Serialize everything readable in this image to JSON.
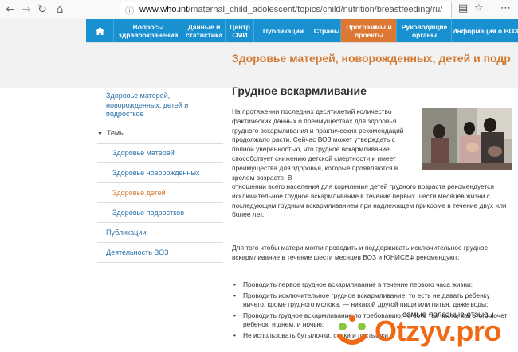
{
  "browser": {
    "url_domain": "www.who.int",
    "url_path": "/maternal_child_adolescent/topics/child/nutrition/breastfeeding/ru/"
  },
  "nav": {
    "items": [
      {
        "label": "Вопросы здравоохранения",
        "active": false
      },
      {
        "label": "Данные и статистика",
        "active": false
      },
      {
        "label": "Центр СМИ",
        "active": false
      },
      {
        "label": "Публикации",
        "active": false
      },
      {
        "label": "Страны",
        "active": false
      },
      {
        "label": "Программы и проекты",
        "active": true
      },
      {
        "label": "Руководящие органы",
        "active": false
      },
      {
        "label": "Информация о ВОЗ",
        "active": false
      }
    ]
  },
  "section_title": "Здоровье матерей, новорожденных, детей и подр",
  "sidebar": {
    "items": [
      {
        "label": "Здоровье матерей, новорожденных, детей и подростков"
      },
      {
        "label": "Темы"
      },
      {
        "label": "Здоровье матерей"
      },
      {
        "label": "Здоровье новорожденных"
      },
      {
        "label": "Здоровье детей"
      },
      {
        "label": "Здоровье подростков"
      },
      {
        "label": "Публикации"
      },
      {
        "label": "Деятельность ВОЗ"
      }
    ]
  },
  "article": {
    "title": "Грудное вскармливание",
    "para1": "На протяжении последних десятилетий количество фактических данных о преимуществах для здоровья грудного вскармливания и практических рекомендаций продолжало расти. Сейчас ВОЗ может утверждать с полной уверенностью, что грудное вскармливание способствует снижению детской смертности и имеет преимущества для здоровья, которые проявляются в зрелом возрасте. В",
    "para1b": "отношении всего населения для кормления детей грудного возраста рекомендуется исключительное грудное вскармливание в течение первых шести месяцев жизни с последующим грудным вскармливанием при надлежащем прикорме в течение двух или более лет.",
    "para2": "Для того чтобы матери могли проводить и поддерживать исключительное грудное вскармливание в течение шести месяцев ВОЗ и ЮНИСЕФ рекомендуют:",
    "bullets": [
      "Проводить первое грудное вскармливание в течение первого часа жизни;",
      "Проводить исключительное грудное вскармливание, то есть не давать ребенку ничего, кроме грудного молока, — никакой другой пищи или питья, даже воды;",
      "Проводить грудное вскармливание по требованию, то есть так часто, как этого хочет ребенок, и днем, и ночью;",
      "Не использовать бутылочки, соски и пустышки."
    ]
  },
  "overlay": {
    "tagline": "самые полезные отзывы",
    "brand": "Otzyv.pro"
  }
}
